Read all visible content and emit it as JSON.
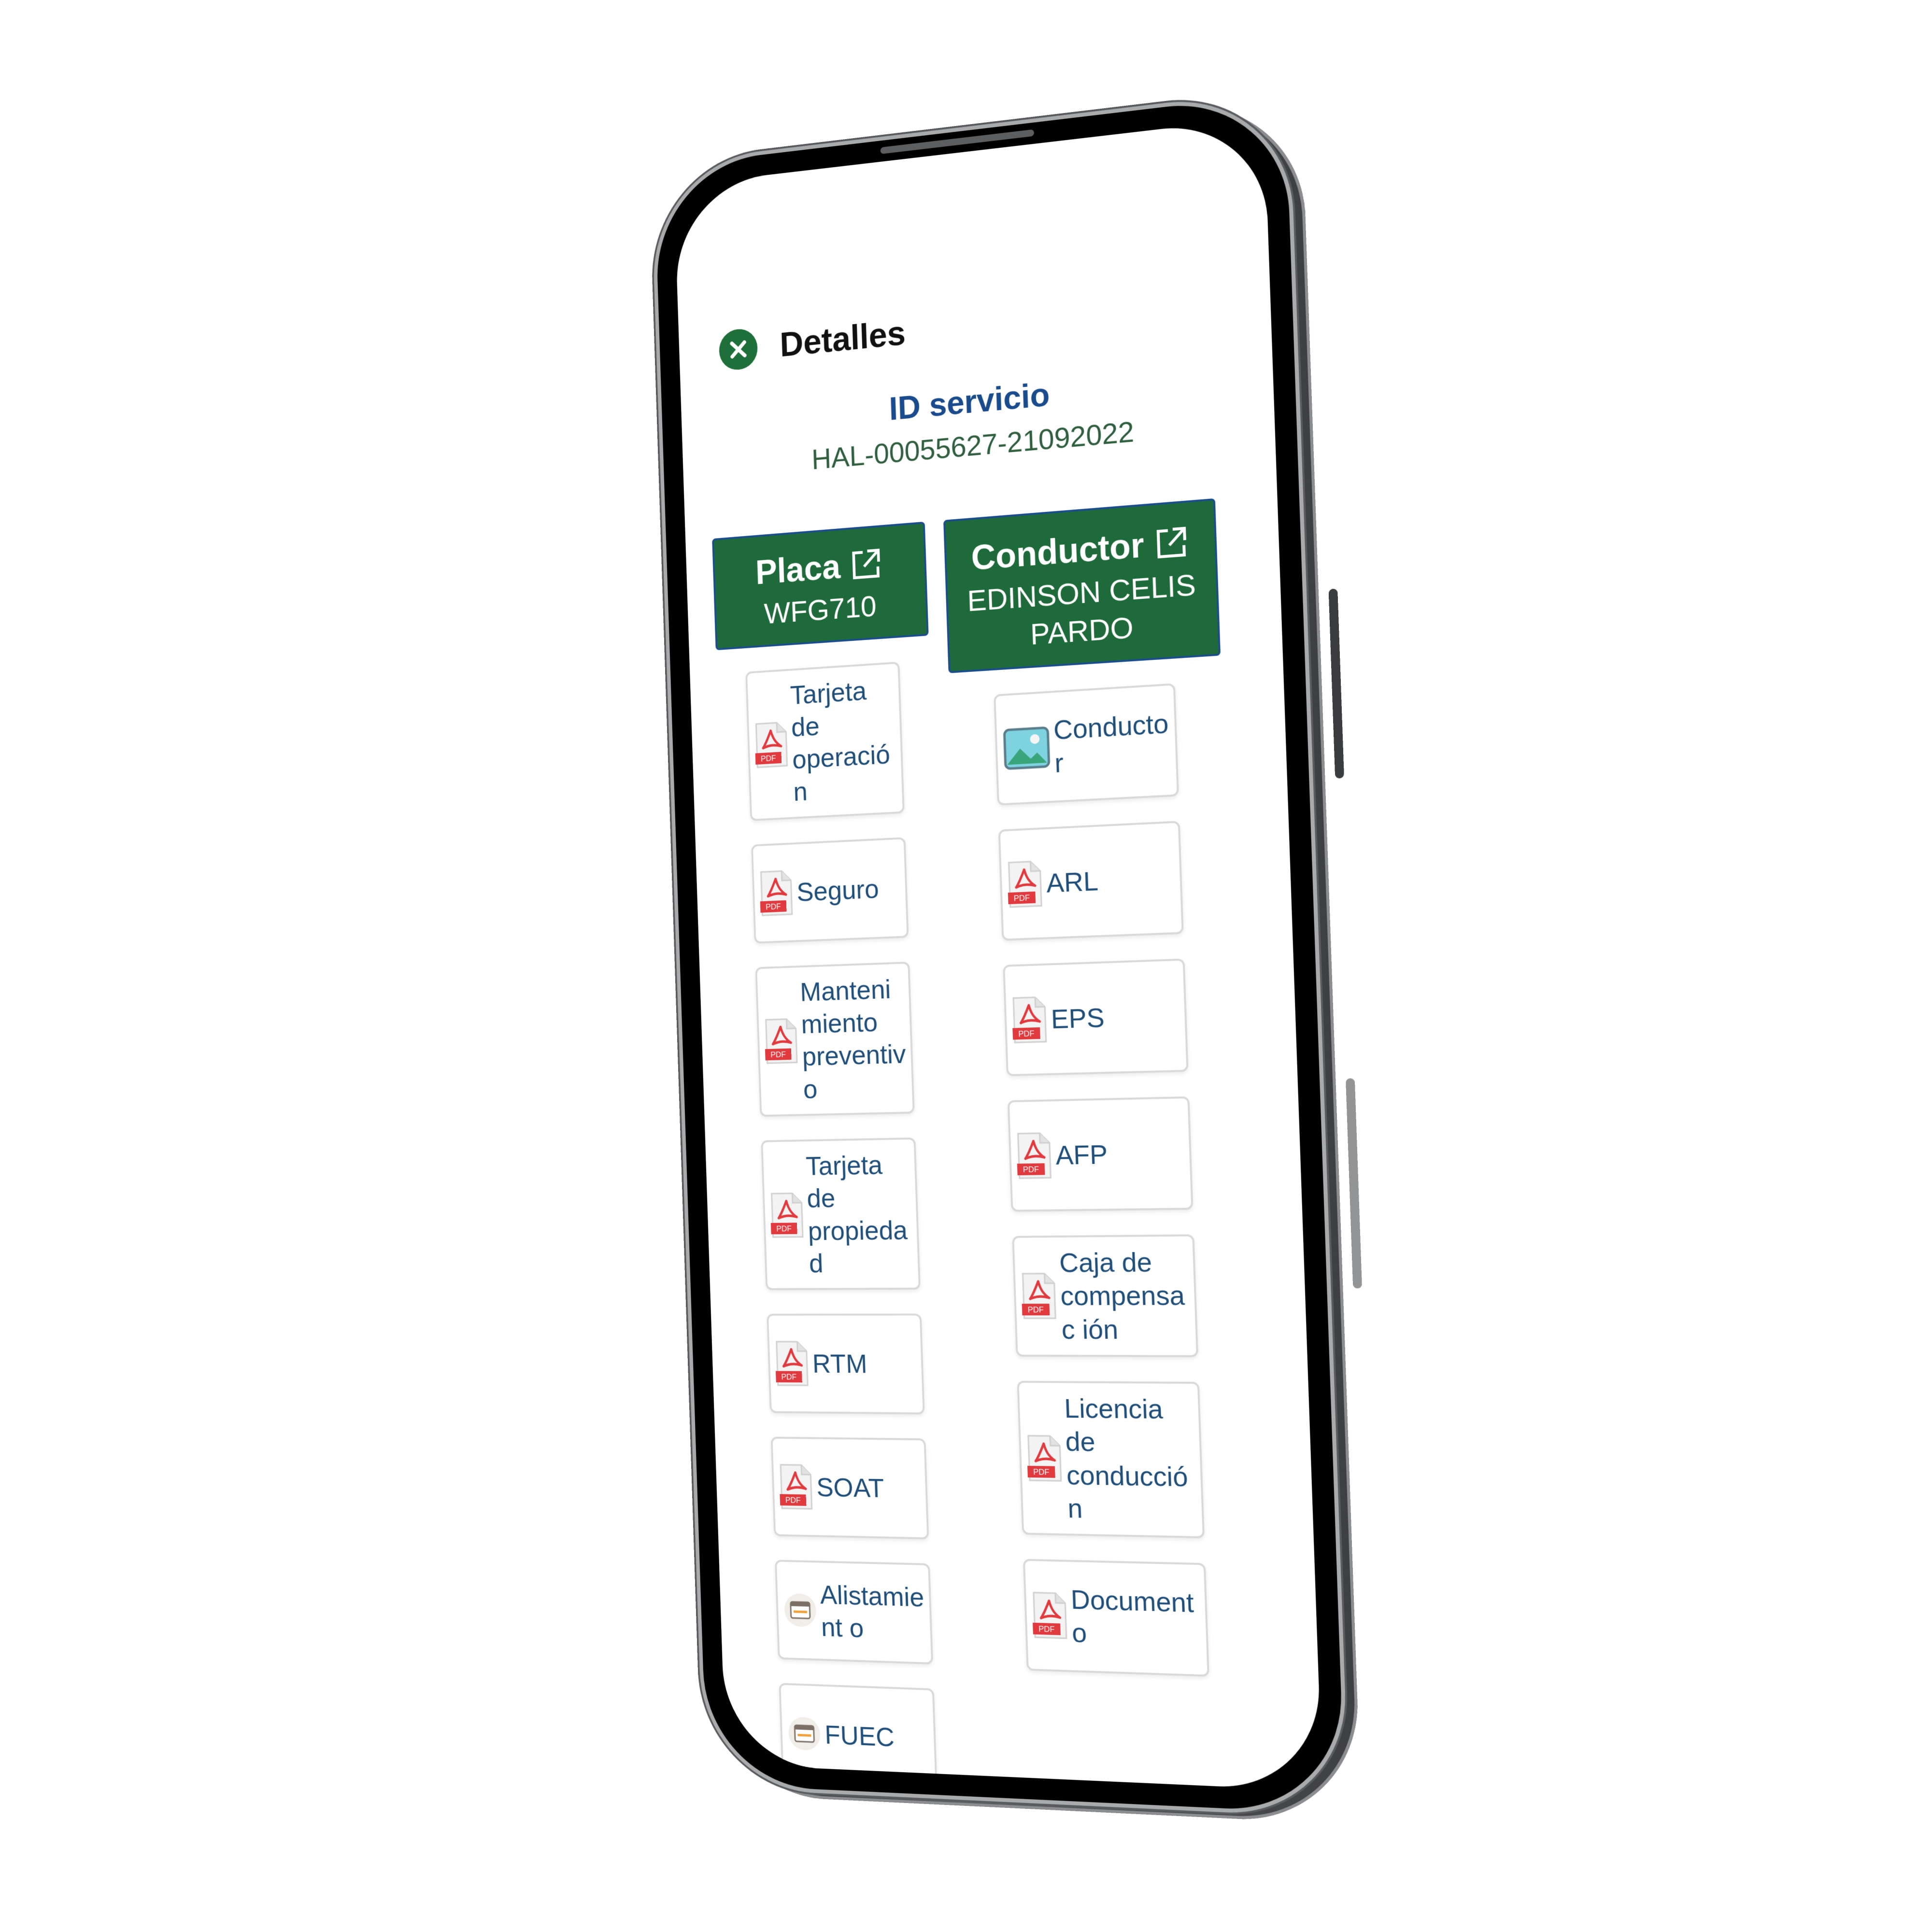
{
  "header": {
    "title": "Detalles"
  },
  "service": {
    "label": "ID servicio",
    "value": "HAL-00055627-21092022"
  },
  "vehicle": {
    "heading": "Placa",
    "plate": "WFG710",
    "documents": [
      {
        "label": "Tarjeta de operación",
        "icon": "pdf-icon"
      },
      {
        "label": "Seguro",
        "icon": "pdf-icon"
      },
      {
        "label": "Manteni miento preventivo",
        "icon": "pdf-icon"
      },
      {
        "label": "Tarjeta de propiedad",
        "icon": "pdf-icon"
      },
      {
        "label": "RTM",
        "icon": "pdf-icon"
      },
      {
        "label": "SOAT",
        "icon": "pdf-icon"
      },
      {
        "label": "Alistamient o",
        "icon": "calendar-icon"
      },
      {
        "label": "FUEC",
        "icon": "calendar-icon"
      }
    ]
  },
  "driver": {
    "heading": "Conductor",
    "name": "EDINSON CELIS PARDO",
    "documents": [
      {
        "label": "Conductor",
        "icon": "image-icon"
      },
      {
        "label": "ARL",
        "icon": "pdf-icon"
      },
      {
        "label": "EPS",
        "icon": "pdf-icon"
      },
      {
        "label": "AFP",
        "icon": "pdf-icon"
      },
      {
        "label": "Caja de compensac ión",
        "icon": "pdf-icon"
      },
      {
        "label": "Licencia de conducción",
        "icon": "pdf-icon"
      },
      {
        "label": "Documento",
        "icon": "pdf-icon"
      }
    ]
  },
  "colors": {
    "primary_green": "#1e6a3a",
    "heading_blue": "#1a4b8c",
    "doc_text": "#1f4e79",
    "pdf_red": "#e0393e"
  }
}
